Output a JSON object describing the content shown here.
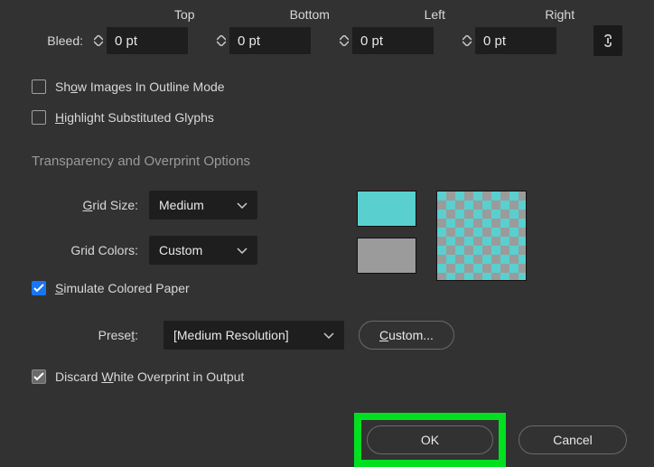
{
  "bleed": {
    "label": "Bleed:",
    "headers": [
      "Top",
      "Bottom",
      "Left",
      "Right"
    ],
    "values": [
      "0 pt",
      "0 pt",
      "0 pt",
      "0 pt"
    ]
  },
  "checkboxes": {
    "show_images": {
      "label_pre": "Sh",
      "ul": "o",
      "label_post": "w Images In Outline Mode",
      "checked": false
    },
    "highlight_glyphs": {
      "label_pre": "",
      "ul": "H",
      "label_post": "ighlight Substituted Glyphs",
      "checked": false
    },
    "simulate_paper": {
      "label_pre": "",
      "ul": "S",
      "label_post": "imulate Colored Paper",
      "checked": true
    },
    "discard_overprint": {
      "label_pre": "Discard ",
      "ul": "W",
      "label_post": "hite Overprint in Output",
      "checked": true
    }
  },
  "section_title": "Transparency and Overprint Options",
  "grid": {
    "size_label_pre": "",
    "size_ul": "G",
    "size_label_post": "rid Size:",
    "size_value": "Medium",
    "colors_label": "Grid Colors:",
    "colors_value": "Custom",
    "swatch_colors": {
      "primary": "#59d0cf",
      "secondary": "#9b9b9b"
    }
  },
  "preset": {
    "label_pre": "Prese",
    "ul": "t",
    "label_post": ":",
    "value": "[Medium Resolution]",
    "custom_btn_pre": "",
    "custom_ul": "C",
    "custom_btn_post": "ustom..."
  },
  "buttons": {
    "ok": "OK",
    "cancel": "Cancel"
  }
}
